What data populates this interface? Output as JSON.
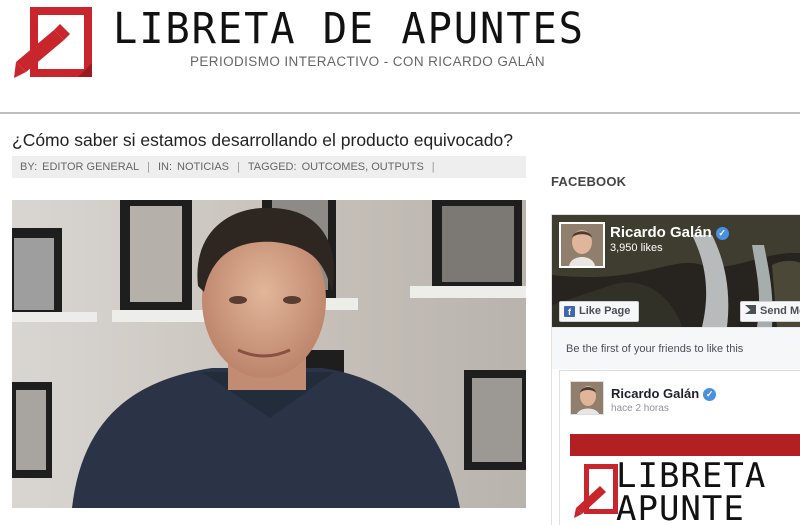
{
  "site": {
    "title": "LIBRETA DE APUNTES",
    "tagline": "PERIODISMO INTERACTIVO - CON RICARDO GALÁN"
  },
  "post": {
    "title": "¿Cómo saber si estamos desarrollando el producto equivocado?",
    "meta": {
      "by_label": "BY:",
      "by_value": "EDITOR GENERAL",
      "in_label": "IN:",
      "in_value": "NOTICIAS",
      "tagged_label": "TAGGED:",
      "tagged_value": "OUTCOMES, OUTPUTS"
    }
  },
  "sidebar": {
    "widget_title": "FACEBOOK",
    "facebook": {
      "page_name": "Ricardo Galán",
      "likes": "3,950 likes",
      "like_button": "Like Page",
      "send_button": "Send Me",
      "friends_text": "Be the first of your friends to like this",
      "post": {
        "author": "Ricardo Galán",
        "time": "hace 2 horas",
        "image_text": "LIBRETA\nAPUNTE"
      }
    }
  },
  "colors": {
    "brand_red": "#c8252c",
    "facebook_blue": "#4267b2",
    "verified_blue": "#4a90e2"
  },
  "icons": [
    "logo-mark",
    "verified-badge-icon",
    "facebook-f-icon",
    "send-icon"
  ]
}
